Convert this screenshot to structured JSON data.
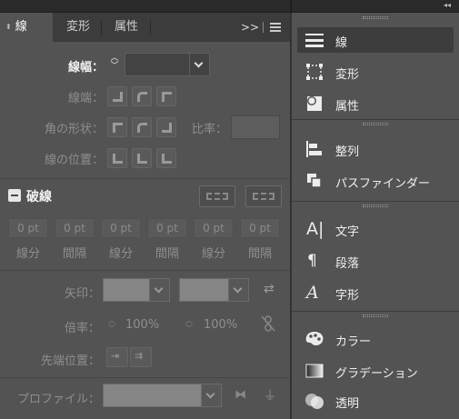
{
  "stroke_panel": {
    "tabs": [
      "線",
      "変形",
      "属性"
    ],
    "more_label": ">>",
    "weight_label": "線幅：",
    "weight_value": "",
    "cap_label": "線端：",
    "corner_label": "角の形状：",
    "limit_label": "比率：",
    "align_label": "線の位置：",
    "dashed": {
      "label": "破線",
      "checked": true,
      "cells": [
        "0 pt",
        "0 pt",
        "0 pt",
        "0 pt",
        "0 pt",
        "0 pt"
      ],
      "cell_labels": [
        "線分",
        "間隔",
        "線分",
        "間隔",
        "線分",
        "間隔"
      ]
    },
    "arrowheads_label": "矢印：",
    "scale_label": "倍率：",
    "scale_values": [
      "100%",
      "100%"
    ],
    "align_tip_label": "先端位置：",
    "profile_label": "プロファイル："
  },
  "right_panel": {
    "groups": [
      {
        "items": [
          {
            "icon": "stroke-lines-icon",
            "label": "線",
            "active": true
          },
          {
            "icon": "transform-icon",
            "label": "変形",
            "active": false
          },
          {
            "icon": "attributes-icon",
            "label": "属性",
            "active": false
          }
        ]
      },
      {
        "items": [
          {
            "icon": "align-icon",
            "label": "整列",
            "active": false
          },
          {
            "icon": "pathfinder-icon",
            "label": "パスファインダー",
            "active": false
          }
        ]
      },
      {
        "items": [
          {
            "icon": "character-icon",
            "label": "文字",
            "active": false
          },
          {
            "icon": "paragraph-icon",
            "label": "段落",
            "active": false
          },
          {
            "icon": "glyphs-icon",
            "label": "字形",
            "active": false
          }
        ]
      },
      {
        "items": [
          {
            "icon": "color-palette-icon",
            "label": "カラー",
            "active": false
          },
          {
            "icon": "gradient-icon",
            "label": "グラデーション",
            "active": false
          },
          {
            "icon": "transparency-icon",
            "label": "透明",
            "active": false
          }
        ]
      }
    ]
  },
  "colors": {
    "panel_bg": "#535353",
    "tab_bg": "#3c3c3c",
    "active_item_bg": "#3d3d3d"
  }
}
